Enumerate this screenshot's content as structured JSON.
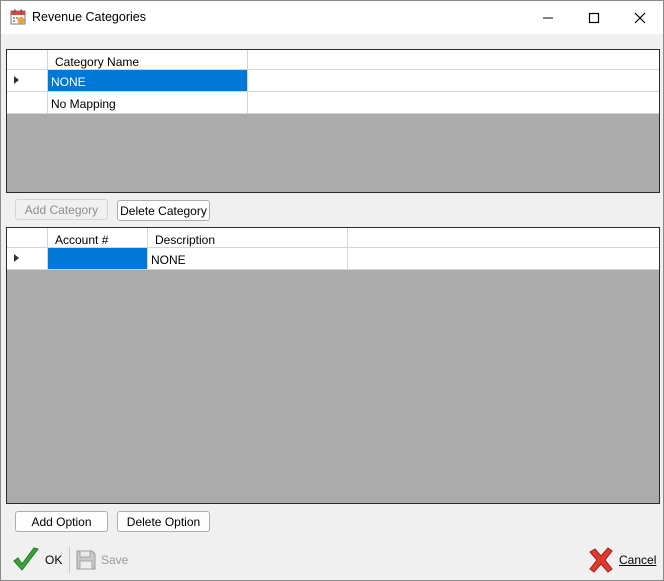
{
  "window": {
    "title": "Revenue Categories",
    "icon": "calendar-app-icon"
  },
  "categories_grid": {
    "columns": [
      "Category Name"
    ],
    "rows": [
      {
        "category_name": "NONE",
        "selected": true,
        "current": true
      },
      {
        "category_name": "No Mapping",
        "selected": false,
        "current": false
      }
    ]
  },
  "category_buttons": {
    "add_label": "Add Category",
    "add_enabled": false,
    "delete_label": "Delete Category"
  },
  "options_grid": {
    "columns": [
      "Account #",
      "Description"
    ],
    "rows": [
      {
        "account": "",
        "description": "NONE",
        "account_selected": true,
        "current": true
      }
    ]
  },
  "option_buttons": {
    "add_label": "Add Option",
    "delete_label": "Delete Option"
  },
  "toolbar": {
    "ok_label": "OK",
    "save_label": "Save",
    "save_enabled": false,
    "cancel_label": "Cancel"
  },
  "colors": {
    "selection": "#0078d7",
    "grid_background": "#ababab",
    "ok_green": "#3aa53a",
    "cancel_red": "#e03a2f"
  }
}
